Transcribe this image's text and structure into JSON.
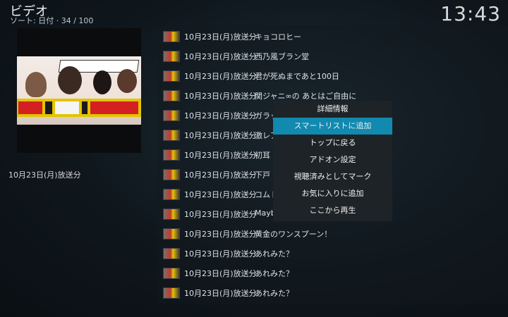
{
  "header": {
    "title": "ビデオ",
    "sort": "ソート: 日付",
    "position": "34 / 100",
    "clock": "13:43"
  },
  "left_panel": {
    "caption": "10月23日(月)放送分"
  },
  "list": {
    "items": [
      {
        "date": "10月23日(月)放送分",
        "title": "キョコロヒー"
      },
      {
        "date": "10月23日(月)放送分",
        "title": "西乃風ブラン堂"
      },
      {
        "date": "10月23日(月)放送分",
        "title": "君が死ぬまであと100日"
      },
      {
        "date": "10月23日(月)放送分",
        "title": "関ジャニ∞の あとはご自由に"
      },
      {
        "date": "10月23日(月)放送分",
        "title": "ガラッ"
      },
      {
        "date": "10月23日(月)放送分",
        "title": "激レア"
      },
      {
        "date": "10月23日(月)放送分",
        "title": "初耳"
      },
      {
        "date": "10月23日(月)放送分",
        "title": "下戸"
      },
      {
        "date": "10月23日(月)放送分",
        "title": "コムト"
      },
      {
        "date": "10月23日(月)放送分",
        "title": "Mayb"
      },
      {
        "date": "10月23日(月)放送分",
        "title": "黄金のワンスプーン！"
      },
      {
        "date": "10月23日(月)放送分",
        "title": "あれみた？"
      },
      {
        "date": "10月23日(月)放送分",
        "title": "あれみた？"
      },
      {
        "date": "10月23日(月)放送分",
        "title": "あれみた？"
      }
    ]
  },
  "context_menu": {
    "items": [
      {
        "label": "詳細情報"
      },
      {
        "label": "スマートリストに追加"
      },
      {
        "label": "トップに戻る"
      },
      {
        "label": "アドオン設定"
      },
      {
        "label": "視聴済みとしてマーク"
      },
      {
        "label": "お気に入りに追加"
      },
      {
        "label": "ここから再生"
      }
    ],
    "selected_index": 1,
    "accent_color": "#1289ae"
  }
}
